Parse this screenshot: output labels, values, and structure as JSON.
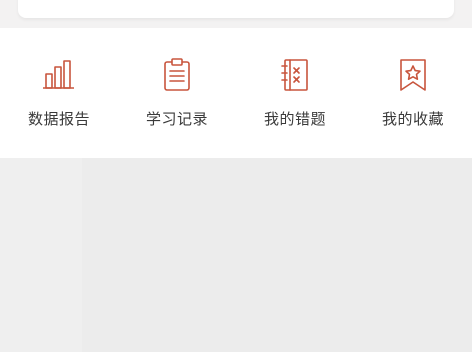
{
  "colors": {
    "background": "#ececec",
    "panel": "#ffffff",
    "icon_accent": "#c8553d",
    "label_text": "#3a3a3a"
  },
  "menu": {
    "items": [
      {
        "label": "数据报告",
        "icon": "bar-chart-icon"
      },
      {
        "label": "学习记录",
        "icon": "clipboard-icon"
      },
      {
        "label": "我的错题",
        "icon": "notebook-icon"
      },
      {
        "label": "我的收藏",
        "icon": "bookmark-star-icon"
      }
    ]
  }
}
